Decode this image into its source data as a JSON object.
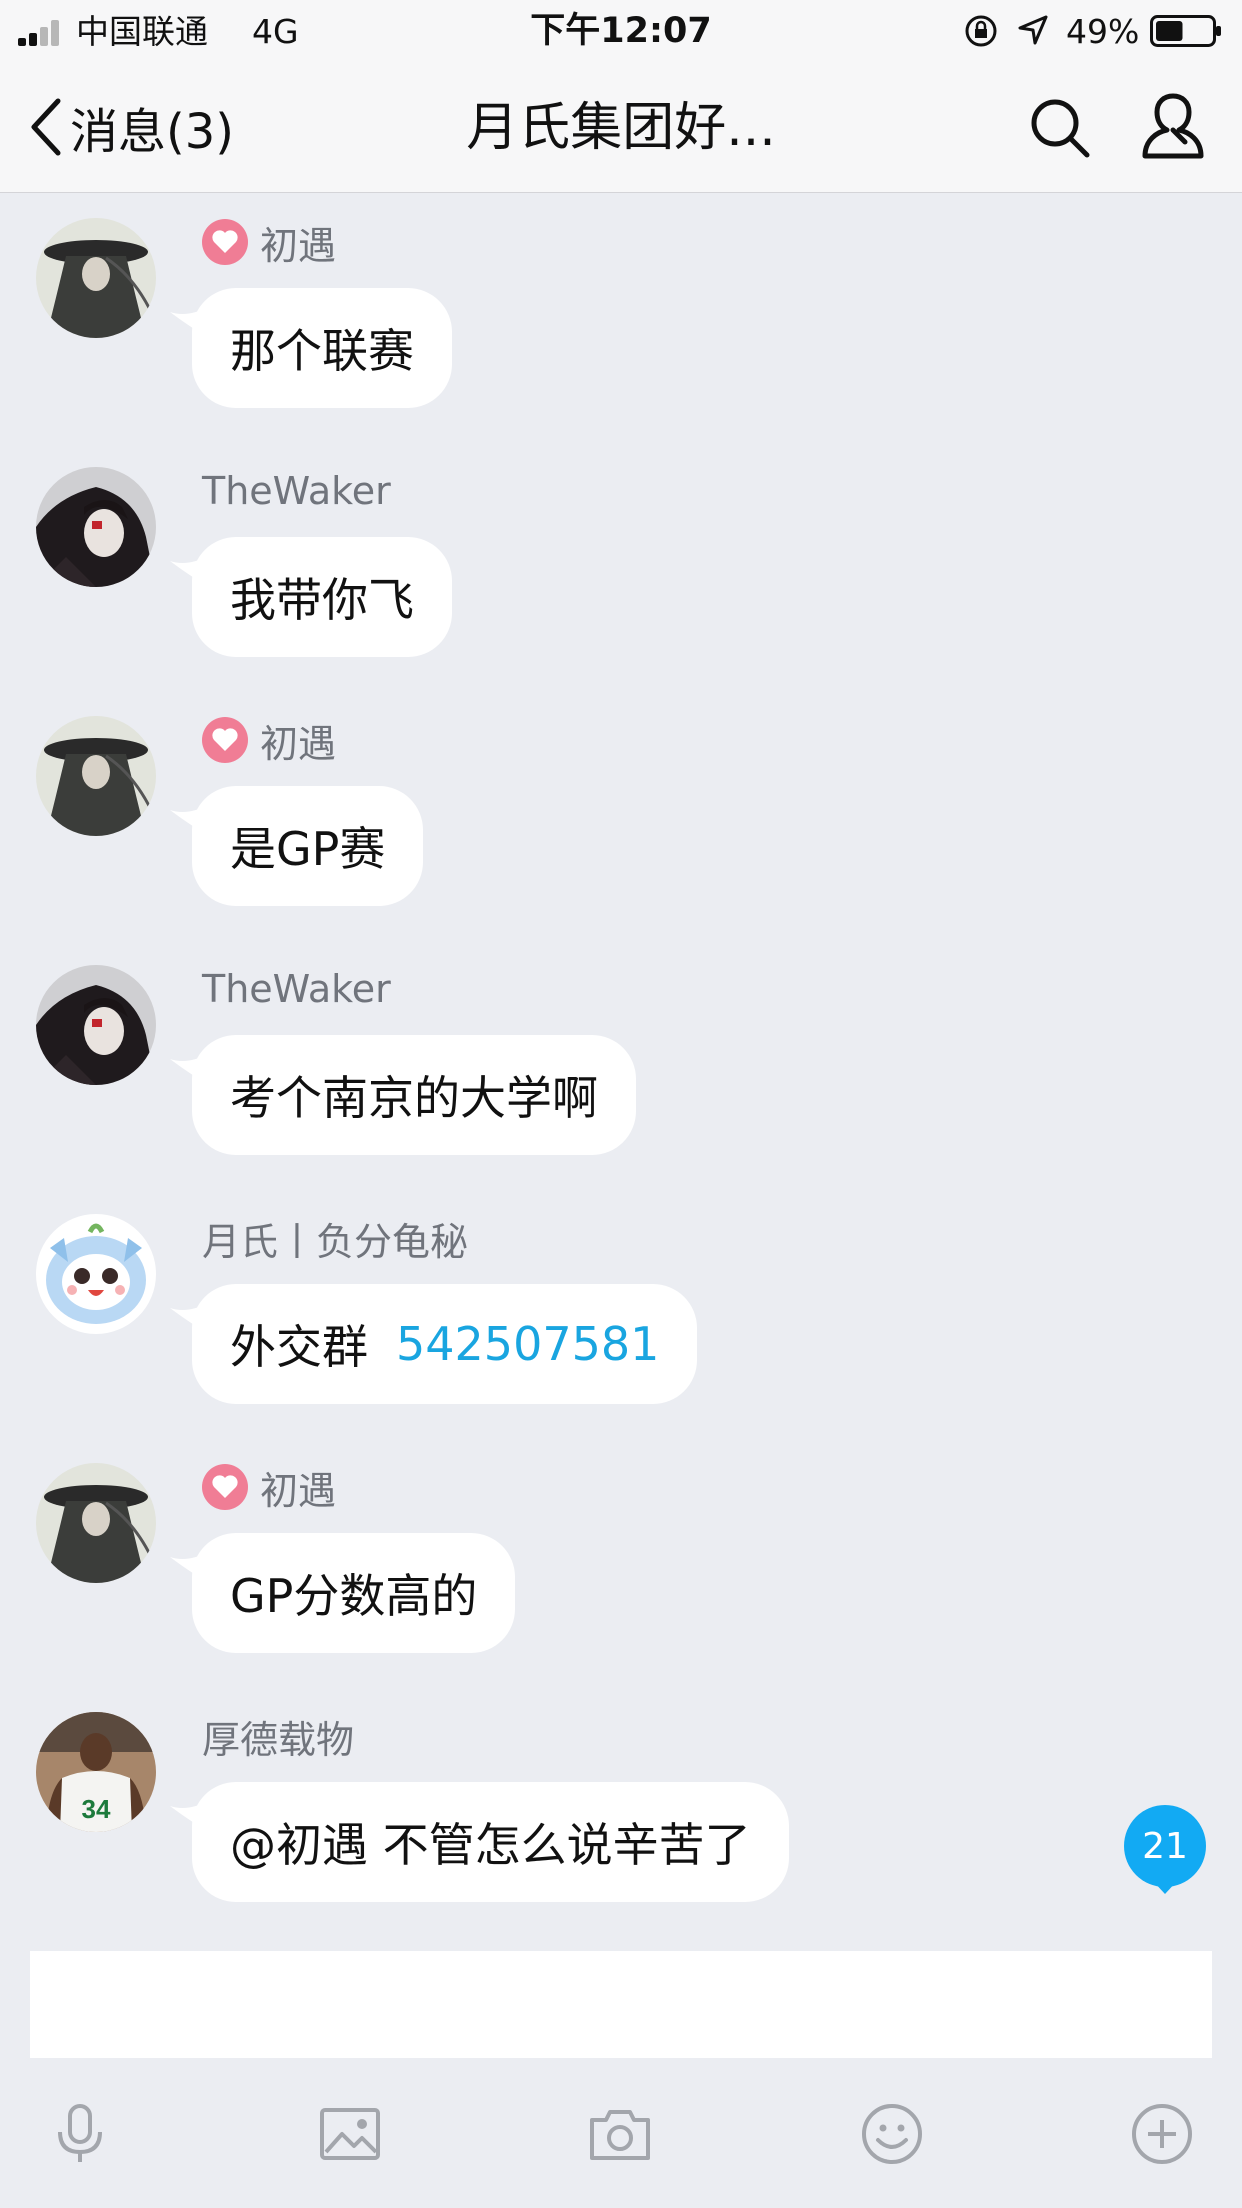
{
  "status_bar": {
    "carrier": "中国联通",
    "network": "4G",
    "time": "下午12:07",
    "battery_percent": "49%",
    "battery_level": 0.49
  },
  "nav": {
    "back_label": "消息(3)",
    "title": "月氏集团好..."
  },
  "messages": [
    {
      "sender": "初遇",
      "has_heart_badge": true,
      "avatar": "avatar-ink-portrait",
      "text": "那个联赛"
    },
    {
      "sender": "TheWaker",
      "has_heart_badge": false,
      "avatar": "avatar-anime-dark",
      "text": "我带你飞"
    },
    {
      "sender": "初遇",
      "has_heart_badge": true,
      "avatar": "avatar-ink-portrait",
      "text": "是GP赛"
    },
    {
      "sender": "TheWaker",
      "has_heart_badge": false,
      "avatar": "avatar-anime-dark",
      "text": "考个南京的大学啊"
    },
    {
      "sender": "月氏丨负分龟秘",
      "has_heart_badge": false,
      "avatar": "avatar-cartoon-owl",
      "text": "外交群",
      "link_number": "542507581"
    },
    {
      "sender": "初遇",
      "has_heart_badge": true,
      "avatar": "avatar-ink-portrait",
      "text": "GP分数高的"
    },
    {
      "sender": "厚德载物",
      "has_heart_badge": false,
      "avatar": "avatar-basketball-player",
      "text": "@初遇 不管怎么说辛苦了"
    }
  ],
  "unread_badge": "21",
  "jersey_number": "34",
  "toolbar": {
    "icons": [
      "microphone-icon",
      "image-icon",
      "camera-icon",
      "emoji-icon",
      "plus-icon"
    ]
  },
  "colors": {
    "background": "#ebedf2",
    "bubble": "#ffffff",
    "link": "#19a5e0",
    "unread_badge": "#12aaf3",
    "heart_badge": "#f07d95"
  }
}
